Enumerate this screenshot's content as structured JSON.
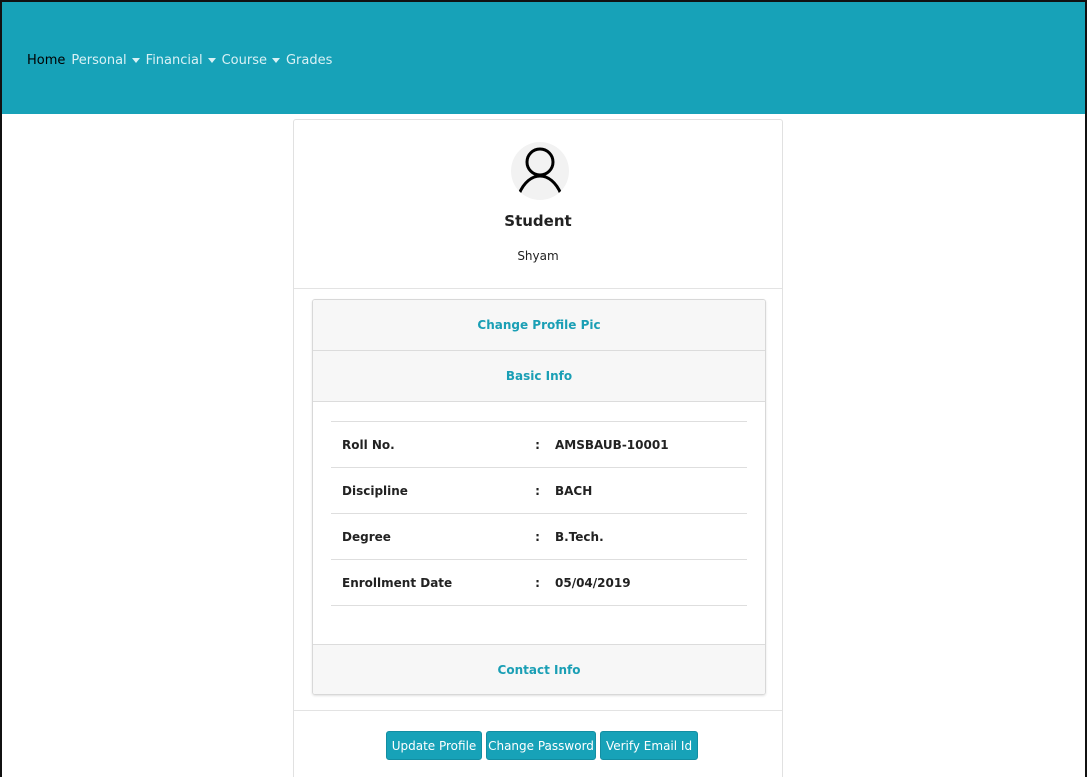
{
  "nav": {
    "home": "Home",
    "personal": "Personal",
    "financial": "Financial",
    "course": "Course",
    "grades": "Grades"
  },
  "profile": {
    "role": "Student",
    "name": "Shyam"
  },
  "accordion": {
    "change_pic": "Change Profile Pic",
    "basic_info": "Basic Info",
    "contact_info": "Contact Info"
  },
  "basic_info": {
    "rows": [
      {
        "label": "Roll No.",
        "sep": ":",
        "value": "AMSBAUB-10001"
      },
      {
        "label": "Discipline",
        "sep": ":",
        "value": "BACH"
      },
      {
        "label": "Degree",
        "sep": ":",
        "value": "B.Tech."
      },
      {
        "label": "Enrollment Date",
        "sep": ":",
        "value": "05/04/2019"
      }
    ]
  },
  "actions": {
    "update_profile": "Update Profile",
    "change_password": "Change Password",
    "verify_email": "Verify Email Id"
  },
  "colors": {
    "navbar": "#17a2b8",
    "accent_text": "#1a9fb5"
  }
}
